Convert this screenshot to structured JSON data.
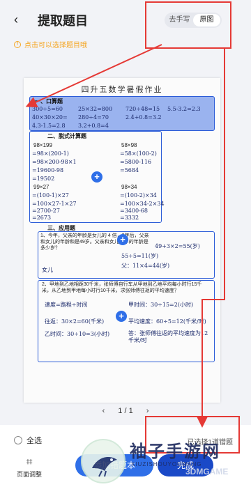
{
  "header": {
    "title": "提取题目",
    "back_icon": "‹",
    "mode_toggle": {
      "options": [
        "去手写",
        "原图"
      ],
      "active": "原图"
    }
  },
  "tip": {
    "text": "点击可以选择题目哦"
  },
  "paper": {
    "title": "四升五数学暑假作业",
    "sections": {
      "oral": {
        "label": "一、口算题",
        "items": [
          "300÷5=60",
          "25×32=800",
          "720÷48=15",
          "5.5-3.2=2.3",
          "40×30×20=",
          "280÷4=70",
          "2.4+0.8=3.2",
          "",
          "4.3-1.5=2.8",
          "3.2+0.8=4",
          "",
          ""
        ]
      },
      "calc": {
        "label": "二、脱式计算题",
        "left": [
          "98×199",
          "=98×(200-1)",
          "=98×200-98×1",
          "=19600-98",
          "=19502",
          "99×27",
          "=(100-1)×27",
          "=100×27-1×27",
          "=2700-27",
          "=2673"
        ],
        "right": [
          "58×98",
          "=58×(100-2)",
          "=5800-116",
          "=5684",
          "",
          "98×34",
          "=(100-2)×34",
          "=100×34-2×34",
          "=3400-68",
          "=3332"
        ]
      },
      "word": {
        "label": "三、应用题",
        "q1": "1、今年，父亲的年龄是女儿的 4 倍，3年后，父亲和女儿的年龄和是49岁。父亲和女儿今年的年龄是多少岁？",
        "q1_hw": [
          "49+3×2=55(岁)",
          "55÷5=11(岁)",
          "父：11×4=44(岁)",
          "女儿"
        ],
        "q2": "2、甲地到乙地相距30千米，张师傅自行车从甲地到乙地平均每小时行15千米，从乙地到甲地每小时行10千米，求张师傅往返的平均速度？",
        "q2_hw": [
          "速度=路程÷时间",
          "甲时间：30÷15=2(小时)",
          "往返：30×2=60(千米)",
          "乙时间：30÷10=3(小时)",
          "平均速度：60÷5=12(千米/时)",
          "答：张师傅往返的平均速度为12千米/时"
        ]
      }
    }
  },
  "pager": {
    "prev": "‹",
    "label": "1 / 1",
    "next": "›"
  },
  "bottom": {
    "select_all": "全选",
    "selected_count": "已选择1道错题",
    "adjust_label": "页面调整",
    "add_button": "添加错题本",
    "confirm_button": "完成"
  },
  "watermark": {
    "text": "袖子手游网",
    "sub": "XIUZISHOUYOUWANG",
    "tag": "3DMGAME"
  },
  "colors": {
    "accent": "#2f6fe8",
    "annotation": "#e53935",
    "tip": "#f5a623"
  }
}
